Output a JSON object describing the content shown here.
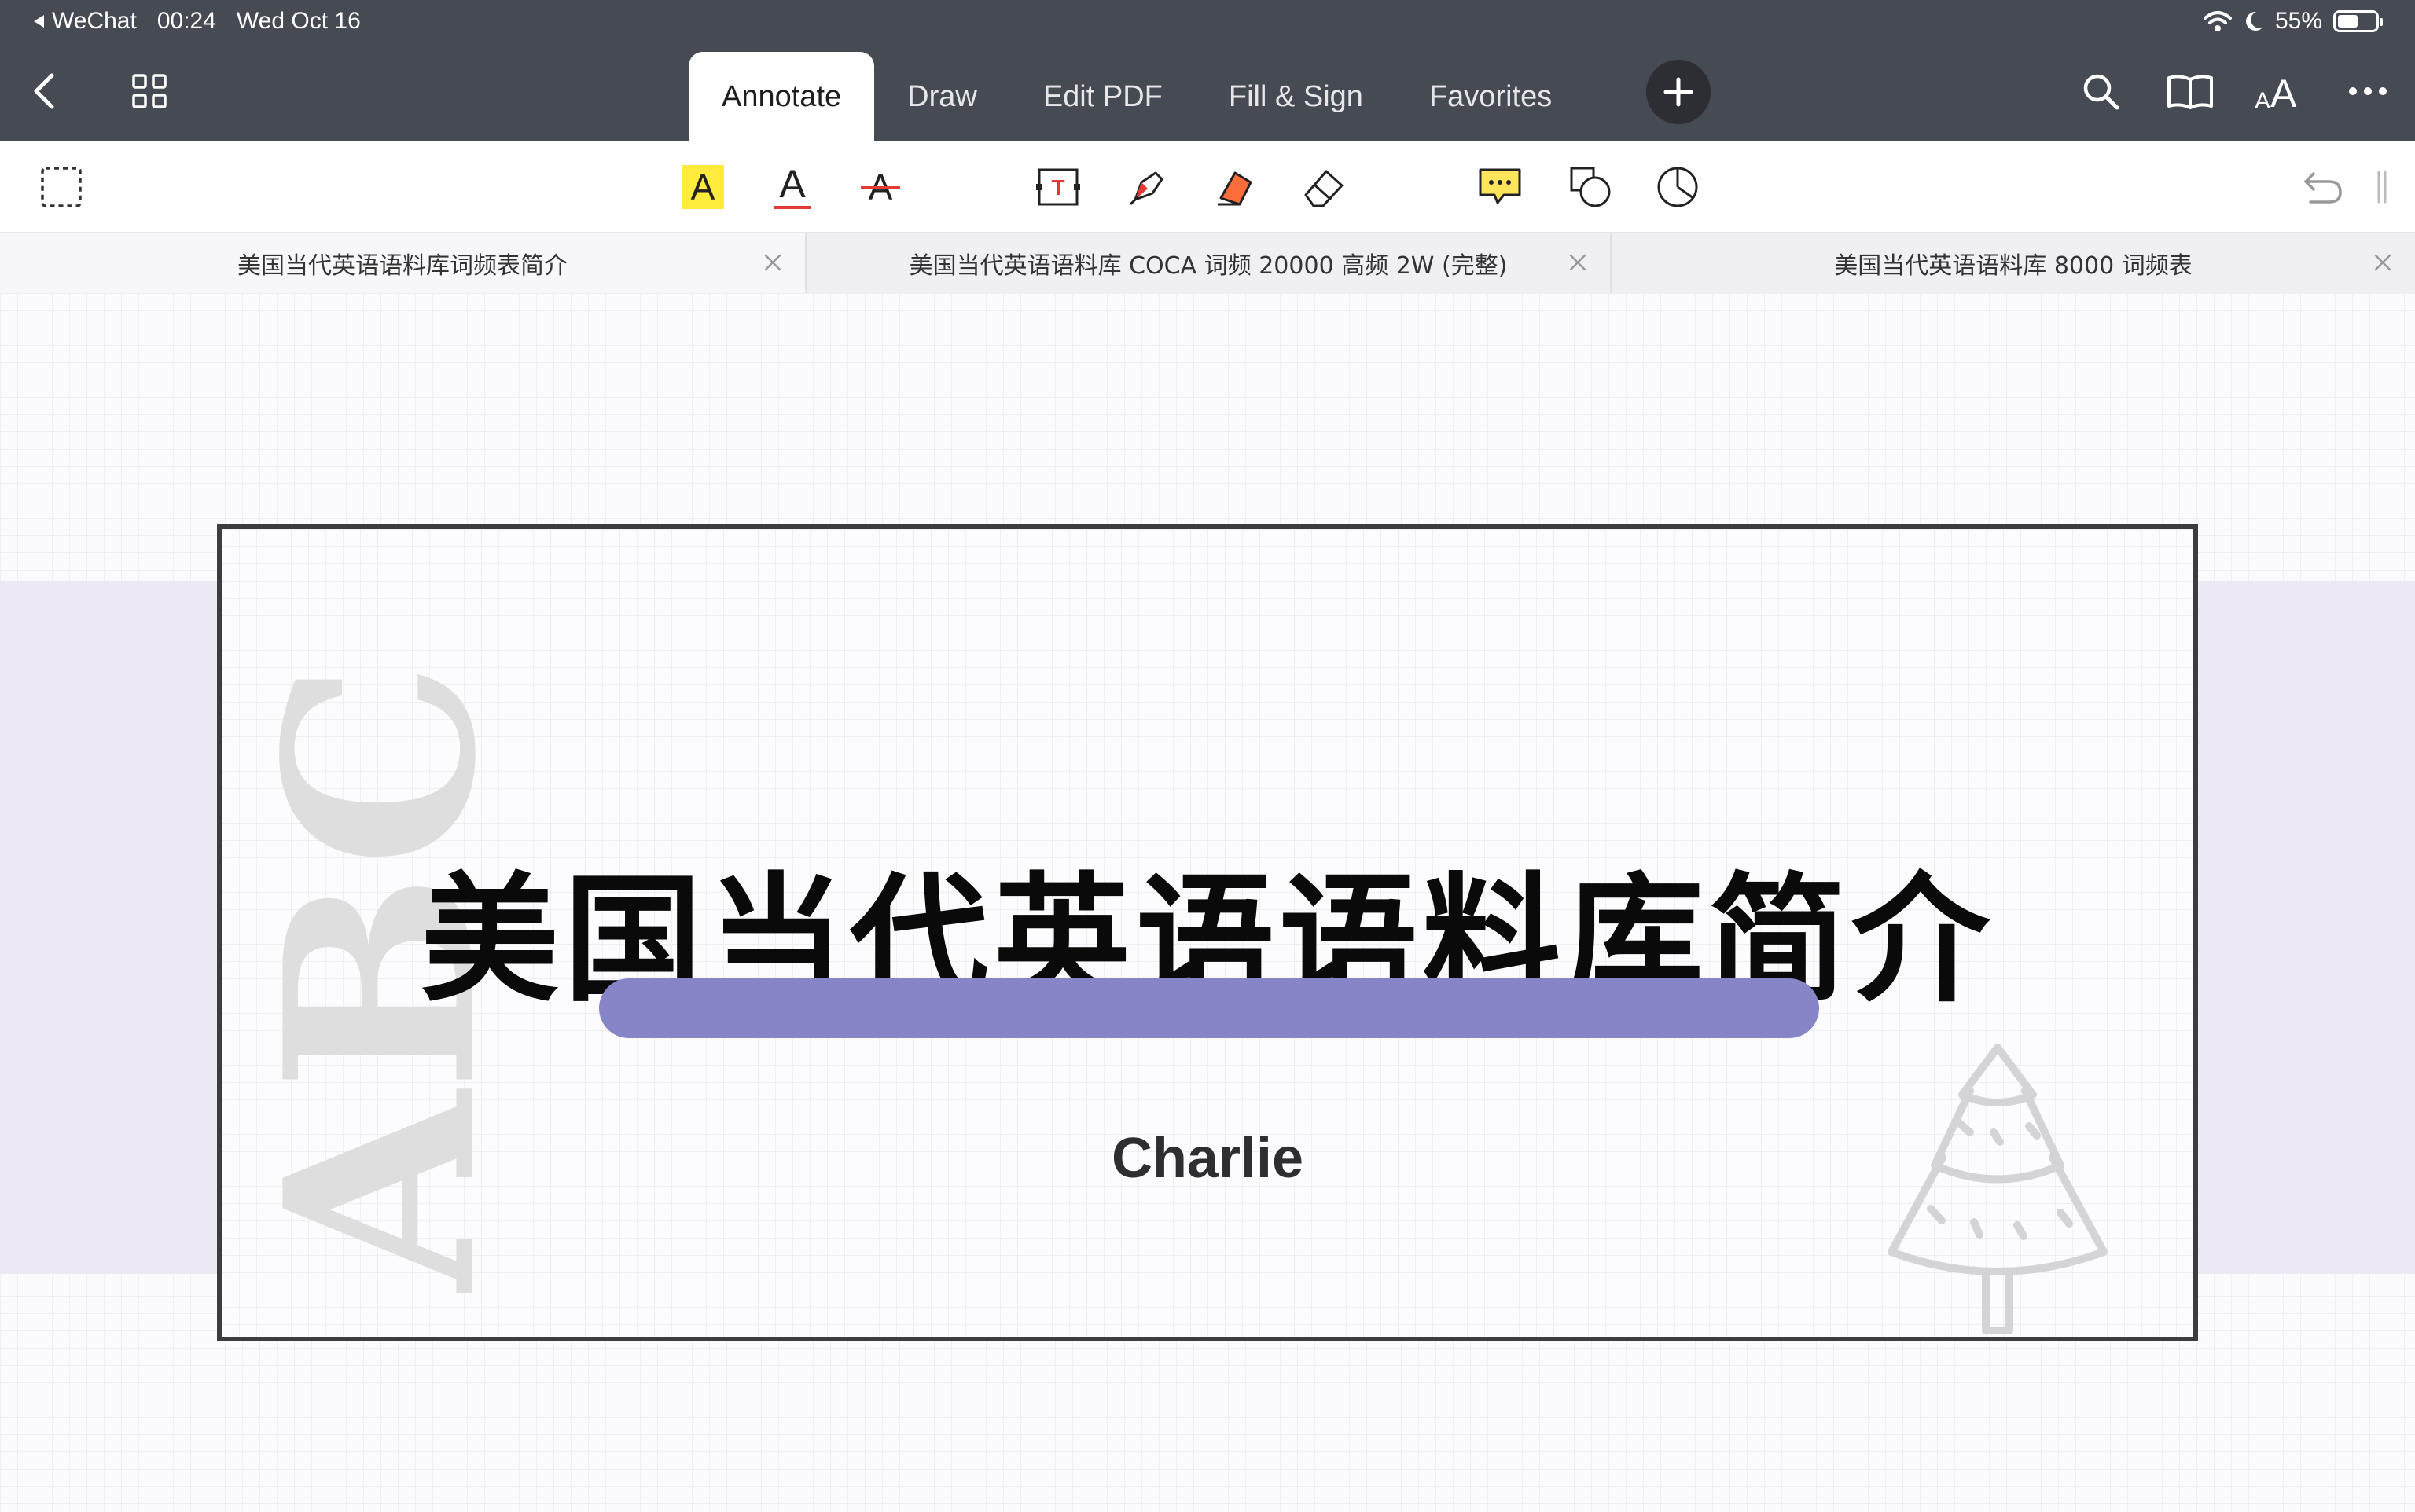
{
  "status_bar": {
    "back_app": "WeChat",
    "time": "00:24",
    "date": "Wed Oct 16",
    "battery": "55%",
    "battery_level": 0.55
  },
  "nav_tabs": [
    "Annotate",
    "Draw",
    "Edit PDF",
    "Fill & Sign",
    "Favorites"
  ],
  "active_nav_tab": "Annotate",
  "toolbar": {
    "tools": [
      "select-rect",
      "highlight",
      "underline",
      "strikethrough",
      "text-box",
      "pen",
      "highlighter",
      "eraser",
      "comment",
      "shapes",
      "lasso-shape"
    ],
    "highlight_glyph": "A",
    "underline_glyph": "A",
    "strike_glyph": "A",
    "textbox_glyph": "T"
  },
  "doc_tabs": [
    {
      "title": "美国当代英语语料库词频表简介",
      "active": true
    },
    {
      "title": "美国当代英语语料库 COCA 词频 20000 高频 2W (完整)",
      "active": false
    },
    {
      "title": "美国当代英语语料库 8000 词频表",
      "active": false
    }
  ],
  "slide": {
    "title": "美国当代英语语料库简介",
    "author": "Charlie",
    "watermark": "ABC",
    "accent_color": "#8685c8"
  },
  "colors": {
    "topbar": "#464a53",
    "highlight_yellow": "#ffeb3b",
    "tool_red": "#e53935",
    "tool_orange": "#ff6d3a",
    "band": "#eeeaf3"
  }
}
